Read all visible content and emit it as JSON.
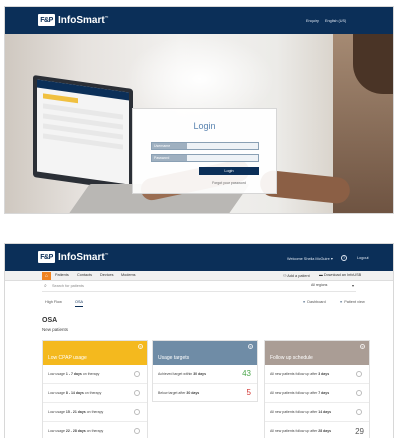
{
  "brand": {
    "logo_mark": "F&P",
    "name": "InfoSmart",
    "tm": "™"
  },
  "login_screen": {
    "header_links": [
      "Enquiry",
      "English (US)"
    ],
    "title": "Login",
    "username_label": "Username",
    "password_label": "Password",
    "login_button": "Login",
    "forgot_link": "Forgot your password"
  },
  "dashboard": {
    "header_links": [
      "Welcome Sheila McGuire ▾",
      "?",
      "Logout"
    ],
    "nav": {
      "home_icon": "home-icon",
      "items": [
        "Patients",
        "Contacts",
        "Devices",
        "Modems"
      ],
      "right_links": [
        "Add a patient",
        "Download an InfoUSB"
      ]
    },
    "search_placeholder": "Search for patients",
    "region_select": "All regions",
    "tabs": [
      "High Flow",
      "OSA"
    ],
    "active_tab": "OSA",
    "view_links": [
      "Dashboard",
      "Patient view"
    ],
    "section_title": "OSA",
    "section_subtitle": "New patients",
    "colors": {
      "header": "#0b2f58",
      "accent_orange": "#f0821e",
      "card_low_cpap": "#f4b91e",
      "card_usage": "#6f8ca6",
      "card_follow": "#aa9d95",
      "good": "#4aa54a",
      "bad": "#d2302c"
    },
    "cards": [
      {
        "title": "Low CPAP usage",
        "rows": [
          {
            "prefix": "Low usage ",
            "bold": "1 - 7 days",
            "suffix": " on therapy",
            "value": ""
          },
          {
            "prefix": "Low usage ",
            "bold": "8 - 14 days",
            "suffix": " on therapy",
            "value": ""
          },
          {
            "prefix": "Low usage ",
            "bold": "15 - 21 days",
            "suffix": " on therapy",
            "value": ""
          },
          {
            "prefix": "Low usage ",
            "bold": "22 - 28 days",
            "suffix": " on therapy",
            "value": ""
          }
        ]
      },
      {
        "title": "Usage targets",
        "rows": [
          {
            "prefix": "Achieved target within ",
            "bold": "30 days",
            "suffix": "",
            "value": "43"
          },
          {
            "prefix": "Below target after ",
            "bold": "30 days",
            "suffix": "",
            "value": "5"
          }
        ]
      },
      {
        "title": "Follow up schedule",
        "rows": [
          {
            "prefix": "All new patients follow up after ",
            "bold": "3 days",
            "suffix": "",
            "value": ""
          },
          {
            "prefix": "All new patients follow up after ",
            "bold": "7 days",
            "suffix": "",
            "value": ""
          },
          {
            "prefix": "All new patients follow up after ",
            "bold": "14 days",
            "suffix": "",
            "value": ""
          },
          {
            "prefix": "All new patients follow up after ",
            "bold": "28 days",
            "suffix": "",
            "value": "29"
          }
        ]
      }
    ]
  }
}
